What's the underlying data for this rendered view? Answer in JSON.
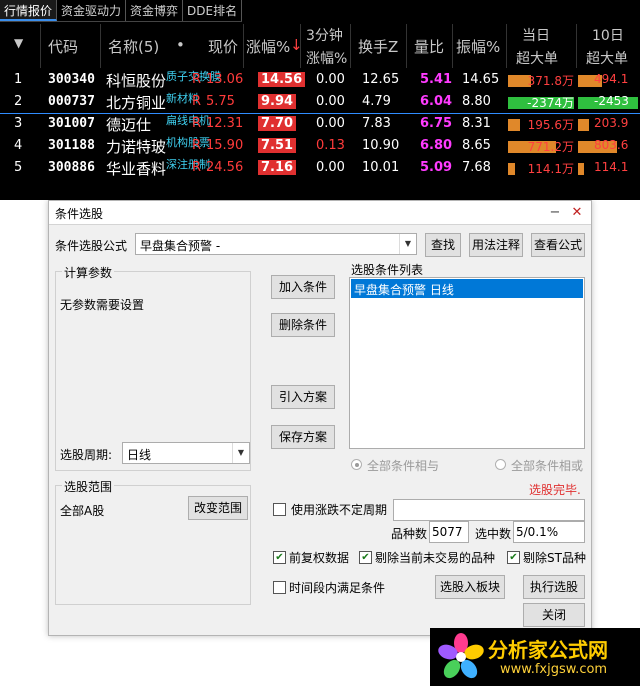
{
  "tabs": [
    "行情报价",
    "资金驱动力",
    "资金博弈",
    "DDE排名"
  ],
  "headers": {
    "code": "代码",
    "name": "名称(5)",
    "dot": "•",
    "price": "现价",
    "change_pct": "涨幅%",
    "change_arrow": "↓",
    "three_min_1": "3分钟",
    "three_min_2": "涨幅%",
    "turnover": "换手Z",
    "volume_ratio": "量比",
    "amplitude": "振幅%",
    "day_1": "当日",
    "day_2": "超大单",
    "ten_day_1": "10日",
    "ten_day_2": "超大单",
    "sort_icon": "▼"
  },
  "rows": [
    {
      "idx": "1",
      "code": "300340",
      "name": "科恒股份",
      "tag": "质子交换膜",
      "price": "13.06",
      "change": "14.56",
      "three_min": "0.00",
      "turnover": "12.65",
      "vol_ratio": "5.41",
      "amplitude": "14.65",
      "day_big": "371.8万",
      "ten_big": "494.1",
      "day_fill": 0.35,
      "ten_fill": 0.4,
      "day_color": "#e0882a",
      "ten_color": "#e0882a"
    },
    {
      "idx": "2",
      "code": "000737",
      "name": "北方铜业",
      "tag": "新材料",
      "price": "5.75",
      "change": "9.94",
      "three_min": "0.00",
      "turnover": "4.79",
      "vol_ratio": "6.04",
      "amplitude": "8.80",
      "day_big": "-2374万",
      "ten_big": "-2453",
      "day_fill": 1.0,
      "ten_fill": 1.0,
      "day_color": "#2fbf3f",
      "ten_color": "#2fbf3f"
    },
    {
      "idx": "3",
      "code": "301007",
      "name": "德迈仕",
      "tag": "扁线电机",
      "price": "12.31",
      "change": "7.70",
      "three_min": "0.00",
      "turnover": "7.83",
      "vol_ratio": "6.75",
      "amplitude": "8.31",
      "day_big": "195.6万",
      "ten_big": "203.9",
      "day_fill": 0.18,
      "ten_fill": 0.18,
      "day_color": "#e0882a",
      "ten_color": "#e0882a"
    },
    {
      "idx": "4",
      "code": "301188",
      "name": "力诺特玻",
      "tag": "机构股票",
      "price": "15.90",
      "change": "7.51",
      "three_min": "0.13",
      "turnover": "10.90",
      "vol_ratio": "6.80",
      "amplitude": "8.65",
      "day_big": "771.2万",
      "ten_big": "803.6",
      "day_fill": 0.72,
      "ten_fill": 0.65,
      "day_color": "#e0882a",
      "ten_color": "#e0882a"
    },
    {
      "idx": "5",
      "code": "300886",
      "name": "华业香料",
      "tag": "深注册制",
      "price": "24.56",
      "change": "7.16",
      "three_min": "0.00",
      "turnover": "10.01",
      "vol_ratio": "5.09",
      "amplitude": "7.68",
      "day_big": "114.1万",
      "ten_big": "114.1",
      "day_fill": 0.1,
      "ten_fill": 0.1,
      "day_color": "#e0882a",
      "ten_color": "#e0882a"
    }
  ],
  "row_flag": "R",
  "dialog": {
    "title": "条件选股",
    "formula_label": "条件选股公式",
    "formula_value": "早盘集合预警 -",
    "find_btn": "查找",
    "usage_btn": "用法注释",
    "view_btn": "查看公式",
    "params_group": "计算参数",
    "params_text": "无参数需要设置",
    "period_label": "选股周期:",
    "period_value": "日线",
    "add_btn": "加入条件",
    "delete_btn": "删除条件",
    "import_btn": "引入方案",
    "save_btn": "保存方案",
    "cond_list_label": "选股条件列表",
    "cond_item": "早盘集合预警  日线",
    "radio_and": "全部条件相与",
    "radio_or": "全部条件相或",
    "status": "选股完毕.",
    "range_group": "选股范围",
    "range_value": "全部A股",
    "change_range_btn": "改变范围",
    "uncertain_label": "使用涨跌不定周期",
    "count_label": "品种数",
    "count_value": "5077",
    "selected_label": "选中数",
    "selected_value": "5/0.1%",
    "opt_fq": "前复权数据",
    "opt_exclude_untraded": "剔除当前未交易的品种",
    "opt_exclude_st": "剔除ST品种",
    "opt_period": "时间段内满足条件",
    "to_block_btn": "选股入板块",
    "run_btn": "执行选股",
    "close_btn": "关闭",
    "minimize": "−",
    "close_x": "✕",
    "check": "✔"
  },
  "watermark": {
    "title": "分析家公式网",
    "url": "www.fxjgsw.com"
  }
}
